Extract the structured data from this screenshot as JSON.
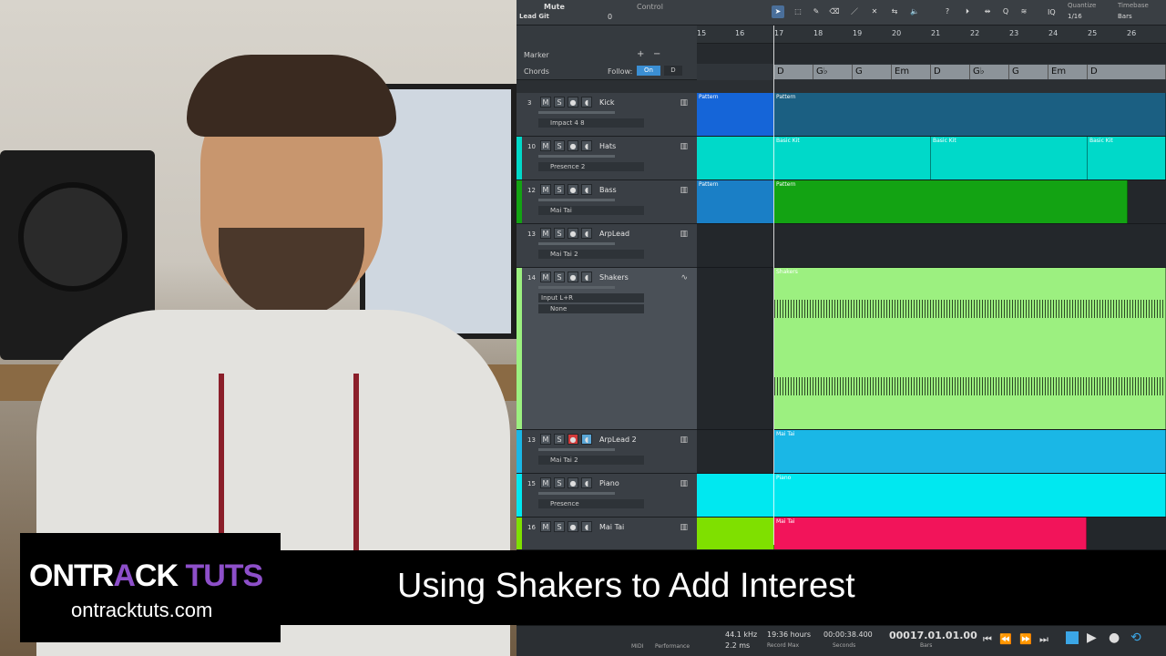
{
  "toolbar": {
    "mute_label": "Mute",
    "track_label": "Lead Git",
    "control_label": "Control",
    "control_value": "0",
    "quantize_label": "Quantize",
    "quantize_value": "1/16",
    "timebase_label": "Timebase",
    "timebase_value": "Bars",
    "iq": "IQ"
  },
  "header": {
    "marker_label": "Marker",
    "chords_label": "Chords",
    "follow_label": "Follow:",
    "follow_on": "On",
    "follow_d": "D"
  },
  "ruler": [
    "15",
    "16",
    "17",
    "18",
    "19",
    "20",
    "21",
    "22",
    "23",
    "24",
    "25",
    "26"
  ],
  "chords": [
    "D",
    "G♭",
    "G",
    "Em",
    "D",
    "G♭",
    "G",
    "Em",
    "D"
  ],
  "tracks": [
    {
      "num": "3",
      "name": "Kick",
      "inst": "Impact 4 8",
      "color": "#1565d8",
      "clips": "Pattern"
    },
    {
      "num": "10",
      "name": "Hats",
      "inst": "Presence 2",
      "color": "#00d9c9",
      "clips": "Basic Kit"
    },
    {
      "num": "12",
      "name": "Bass",
      "inst": "Mai Tai",
      "color": "#13a313",
      "clips": "Pattern"
    },
    {
      "num": "13",
      "name": "ArpLead",
      "inst": "Mai Tai 2",
      "color": "#23272b",
      "clips": ""
    },
    {
      "num": "14",
      "name": "Shakers",
      "inst": "Input L+R",
      "inst2": "None",
      "color": "#9cf080",
      "clips": "Shakers"
    },
    {
      "num": "13",
      "name": "ArpLead 2",
      "inst": "Mai Tai 2",
      "color": "#1ab7e6",
      "clips": "Mai Tai"
    },
    {
      "num": "15",
      "name": "Piano",
      "inst": "Presence",
      "color": "#00e8f0",
      "clips": "Piano"
    },
    {
      "num": "16",
      "name": "Mai Tai",
      "inst": "",
      "color": "#f2145a",
      "clips": "Mai Tai"
    }
  ],
  "status": {
    "midi": "MIDI",
    "performance": "Performance",
    "rate": "44.1 kHz",
    "latency": "2.2 ms",
    "record_max": "19:36 hours",
    "record_max_label": "Record Max",
    "seconds": "00:00:38.400",
    "seconds_label": "Seconds",
    "bars": "00017.01.01.00",
    "bars_label": "Bars"
  },
  "banner": {
    "title": "Using Shakers to Add Interest"
  },
  "logo": {
    "brand_a": "ONTR",
    "brand_b": "A",
    "brand_c": "CK ",
    "brand_d": "TUTS",
    "url": "ontracktuts.com"
  },
  "colors": {
    "accent": "#8d4fc9",
    "daw_bg": "#2b2f33"
  }
}
